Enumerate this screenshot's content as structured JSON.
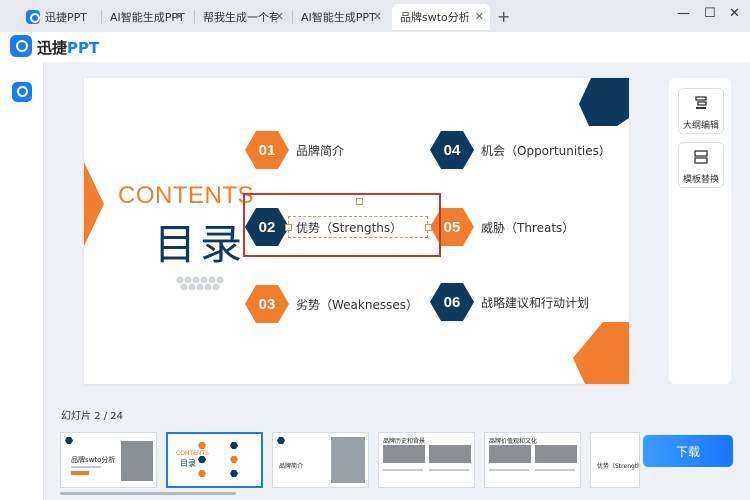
{
  "tabs": [
    {
      "label": "迅捷PPT",
      "active": false,
      "has_logo": true
    },
    {
      "label": "AI智能生成PPT",
      "active": false
    },
    {
      "label": "帮我生成一个有...",
      "active": false
    },
    {
      "label": "AI智能生成PPT",
      "active": false
    },
    {
      "label": "品牌swto分析",
      "active": true
    }
  ],
  "window": {
    "add_tab": "+",
    "minimize": "—",
    "maximize": "☐",
    "close": "✕"
  },
  "brand": {
    "name_prefix": "迅捷",
    "name_suffix": "PPT",
    "accent": "#1a7cf5"
  },
  "slide": {
    "contents_title": "CONTENTS",
    "subtitle": "目录",
    "items": [
      {
        "num": "01",
        "text": "品牌简介",
        "color": "orange"
      },
      {
        "num": "02",
        "text": "优势（Strengths）",
        "color": "navy"
      },
      {
        "num": "03",
        "text": "劣势（Weaknesses）",
        "color": "orange"
      },
      {
        "num": "04",
        "text": "机会（Opportunities）",
        "color": "navy"
      },
      {
        "num": "05",
        "text": "威胁（Threats）",
        "color": "orange"
      },
      {
        "num": "06",
        "text": "战略建议和行动计划",
        "color": "navy"
      }
    ],
    "colors": {
      "orange": "#f07e2c",
      "navy": "#0d3a5c"
    }
  },
  "right_panel": {
    "outline_edit": "大纲编辑",
    "template_replace": "模板替换"
  },
  "thumbnails": {
    "counter": "幻灯片 2 / 24",
    "items": [
      {
        "title": "品牌swto分析"
      },
      {
        "title": "目录"
      },
      {
        "title": "品牌简介"
      },
      {
        "title": "品牌历史和背景"
      },
      {
        "title": "品牌价值观和文化"
      },
      {
        "title": "优势（Strengths）"
      }
    ]
  },
  "download_label": "下载"
}
